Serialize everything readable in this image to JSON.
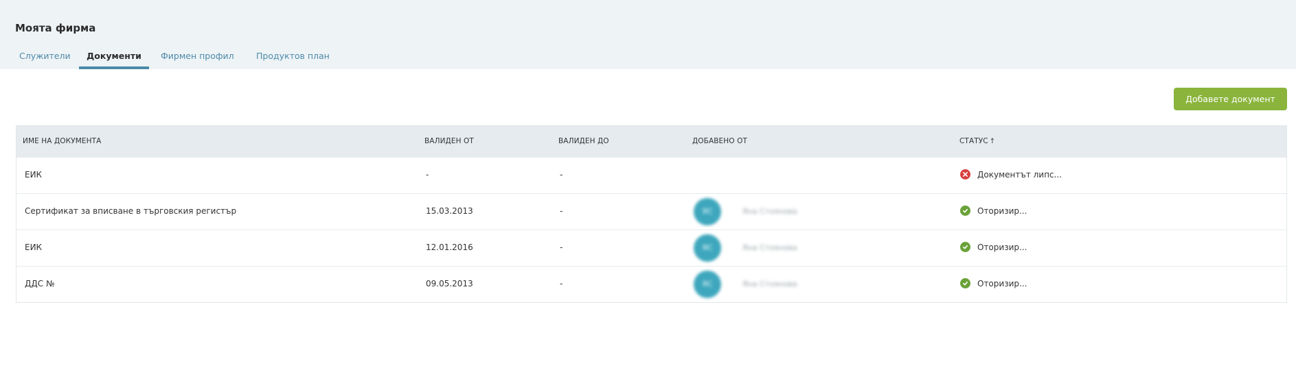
{
  "page": {
    "title": "Моята фирма"
  },
  "tabs": [
    {
      "label": "Служители",
      "active": false
    },
    {
      "label": "Документи",
      "active": true
    },
    {
      "label": "Фирмен профил",
      "active": false
    },
    {
      "label": "Продуктов план",
      "active": false
    }
  ],
  "actions": {
    "add_document": "Добавете документ"
  },
  "table": {
    "columns": {
      "name": "ИМЕ НА ДОКУМЕНТА",
      "valid_from": "ВАЛИДЕН ОТ",
      "valid_to": "ВАЛИДЕН ДО",
      "added_by": "ДОБАВЕНО ОТ",
      "status": "СТАТУС",
      "status_sort": "↑"
    },
    "rows": [
      {
        "name": "ЕИК",
        "valid_from": "-",
        "valid_to": "-",
        "avatar": "",
        "added_by": "",
        "status": "Документът липс...",
        "status_type": "error"
      },
      {
        "name": "Сертификат за вписване в търговския регистър",
        "valid_from": "15.03.2013",
        "valid_to": "-",
        "avatar": "ЯС",
        "added_by": "Яна Стоянова",
        "status": "Оторизир...",
        "status_type": "ok"
      },
      {
        "name": "ЕИК",
        "valid_from": "12.01.2016",
        "valid_to": "-",
        "avatar": "ЯС",
        "added_by": "Яна Стоянова",
        "status": "Оторизир...",
        "status_type": "ok"
      },
      {
        "name": "ДДС №",
        "valid_from": "09.05.2013",
        "valid_to": "-",
        "avatar": "ЯС",
        "added_by": "Яна Стоянова",
        "status": "Оторизир...",
        "status_type": "ok"
      }
    ]
  },
  "colors": {
    "accent": "#4a8aa6",
    "button": "#8ab43b",
    "error": "#d84040",
    "ok": "#6aa238",
    "avatar": "#3ea7bd"
  },
  "icons": {
    "error": "x-circle-icon",
    "ok": "check-circle-icon",
    "sort": "arrow-up-icon"
  }
}
